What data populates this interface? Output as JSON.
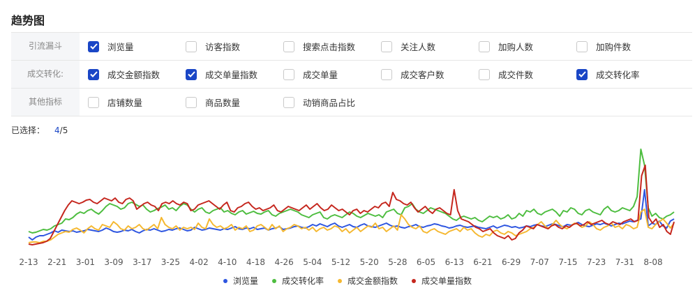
{
  "page_title": "趋势图",
  "filters": [
    {
      "label": "引流漏斗",
      "options": [
        {
          "label": "浏览量",
          "checked": true
        },
        {
          "label": "访客指数",
          "checked": false
        },
        {
          "label": "搜索点击指数",
          "checked": false
        },
        {
          "label": "关注人数",
          "checked": false
        },
        {
          "label": "加购人数",
          "checked": false
        },
        {
          "label": "加购件数",
          "checked": false
        }
      ]
    },
    {
      "label": "成交转化:",
      "options": [
        {
          "label": "成交金额指数",
          "checked": true
        },
        {
          "label": "成交单量指数",
          "checked": true
        },
        {
          "label": "成交单量",
          "checked": false
        },
        {
          "label": "成交客户数",
          "checked": false
        },
        {
          "label": "成交件数",
          "checked": false
        },
        {
          "label": "成交转化率",
          "checked": true
        }
      ]
    },
    {
      "label": "其他指标",
      "options": [
        {
          "label": "店铺数量",
          "checked": false
        },
        {
          "label": "商品数量",
          "checked": false
        },
        {
          "label": "动销商品占比",
          "checked": false
        }
      ]
    }
  ],
  "selection": {
    "label": "已选择：",
    "count": "4",
    "total": "/5"
  },
  "colors": {
    "accent": "#1a46c6",
    "border": "#e6e6e6",
    "header_bg": "#f5f6f8"
  },
  "chart_data": {
    "type": "line",
    "grid": false,
    "legend_position": "bottom",
    "x_ticks": [
      "2-13",
      "2-21",
      "3-01",
      "3-09",
      "3-17",
      "3-25",
      "4-02",
      "4-10",
      "4-18",
      "4-26",
      "5-04",
      "5-12",
      "5-20",
      "5-28",
      "6-05",
      "6-13",
      "6-21",
      "6-29",
      "7-07",
      "7-15",
      "7-23",
      "7-31",
      "8-08"
    ],
    "series": [
      {
        "name": "浏览量",
        "color": "#2d55e0",
        "values": [
          22,
          18,
          22,
          24,
          24,
          26,
          28,
          31,
          29,
          32,
          31,
          30,
          31,
          29,
          30,
          31,
          33,
          32,
          31,
          30,
          32,
          35,
          33,
          30,
          29,
          30,
          32,
          31,
          33,
          30,
          28,
          31,
          33,
          32,
          34,
          32,
          30,
          31,
          33,
          32,
          34,
          35,
          33,
          31,
          32,
          36,
          34,
          32,
          33,
          35,
          34,
          33,
          32,
          34,
          33,
          35,
          37,
          34,
          33,
          35,
          34,
          36,
          33,
          34,
          35,
          32,
          34,
          35,
          37,
          33,
          34,
          35,
          37,
          38,
          36,
          35,
          37,
          40,
          38,
          41,
          39,
          37,
          40,
          42,
          38,
          36,
          38,
          40,
          37,
          36,
          39,
          41,
          38,
          37,
          36,
          38,
          40,
          42,
          39,
          37,
          38,
          36,
          35,
          37,
          38,
          40,
          37,
          36,
          38,
          39,
          41,
          40,
          38,
          37,
          35,
          36,
          38,
          39,
          37,
          36,
          37,
          38,
          36,
          35,
          34,
          36,
          38,
          35,
          37,
          39,
          38,
          36,
          37,
          35,
          36,
          38,
          37,
          39,
          40,
          38,
          37,
          39,
          41,
          40,
          38,
          37,
          40,
          39,
          41,
          43,
          40,
          38,
          37,
          39,
          41,
          40,
          42,
          40,
          38,
          40,
          42,
          41,
          43,
          45,
          44,
          46,
          48,
          90,
          38,
          42,
          40,
          45,
          38,
          35,
          45,
          48
        ]
      },
      {
        "name": "成交转化率",
        "color": "#4dbd3f",
        "values": [
          30,
          28,
          29,
          31,
          33,
          32,
          34,
          38,
          40,
          42,
          48,
          47,
          50,
          55,
          58,
          56,
          60,
          62,
          58,
          55,
          60,
          66,
          70,
          68,
          66,
          62,
          64,
          70,
          72,
          69,
          66,
          68,
          62,
          58,
          60,
          63,
          65,
          68,
          62,
          64,
          60,
          66,
          70,
          68,
          62,
          58,
          62,
          64,
          58,
          56,
          60,
          62,
          64,
          58,
          60,
          56,
          54,
          58,
          60,
          55,
          57,
          59,
          56,
          55,
          58,
          60,
          54,
          52,
          56,
          58,
          60,
          62,
          60,
          58,
          54,
          52,
          50,
          54,
          56,
          58,
          50,
          48,
          52,
          54,
          52,
          50,
          54,
          58,
          56,
          52,
          50,
          53,
          56,
          54,
          52,
          54,
          50,
          58,
          60,
          62,
          56,
          54,
          64,
          66,
          70,
          62,
          58,
          56,
          60,
          64,
          62,
          60,
          58,
          56,
          52,
          48,
          46,
          50,
          52,
          50,
          48,
          50,
          46,
          44,
          48,
          52,
          50,
          52,
          48,
          50,
          54,
          48,
          50,
          56,
          52,
          60,
          58,
          62,
          56,
          54,
          58,
          60,
          62,
          58,
          52,
          60,
          58,
          64,
          62,
          56,
          54,
          60,
          62,
          58,
          56,
          54,
          62,
          66,
          60,
          58,
          60,
          64,
          62,
          60,
          66,
          80,
          148,
          125,
          64,
          52,
          56,
          50,
          48,
          52,
          54,
          58
        ]
      },
      {
        "name": "成交金额指数",
        "color": "#f5b830",
        "values": [
          14,
          15,
          15,
          14,
          16,
          16,
          18,
          22,
          26,
          28,
          30,
          29,
          33,
          35,
          32,
          28,
          34,
          38,
          34,
          32,
          40,
          38,
          36,
          44,
          40,
          34,
          32,
          38,
          34,
          36,
          40,
          34,
          32,
          36,
          40,
          34,
          50,
          40,
          36,
          34,
          38,
          32,
          36,
          34,
          36,
          33,
          42,
          36,
          34,
          48,
          40,
          36,
          38,
          34,
          36,
          40,
          32,
          36,
          34,
          38,
          30,
          32,
          38,
          40,
          36,
          32,
          40,
          34,
          38,
          30,
          34,
          36,
          40,
          38,
          34,
          36,
          32,
          36,
          30,
          34,
          36,
          32,
          34,
          38,
          36,
          30,
          34,
          28,
          32,
          36,
          30,
          34,
          38,
          36,
          42,
          34,
          36,
          30,
          34,
          38,
          32,
          54,
          48,
          40,
          36,
          34,
          38,
          30,
          28,
          32,
          34,
          30,
          28,
          26,
          30,
          32,
          34,
          30,
          36,
          32,
          34,
          28,
          24,
          22,
          26,
          24,
          30,
          32,
          28,
          26,
          30,
          28,
          24,
          26,
          28,
          30,
          34,
          36,
          40,
          44,
          38,
          34,
          40,
          46,
          40,
          36,
          34,
          38,
          42,
          40,
          36,
          38,
          44,
          40,
          34,
          32,
          36,
          38,
          42,
          36,
          38,
          34,
          40,
          38,
          34,
          36,
          58,
          62,
          36,
          34,
          40,
          44,
          48,
          42,
          35,
          42
        ]
      },
      {
        "name": "成交单量指数",
        "color": "#c5261d",
        "values": [
          12,
          11,
          12,
          13,
          14,
          16,
          20,
          30,
          40,
          50,
          60,
          68,
          74,
          72,
          70,
          72,
          75,
          76,
          72,
          70,
          74,
          78,
          76,
          74,
          78,
          72,
          70,
          76,
          78,
          74,
          62,
          66,
          70,
          72,
          68,
          66,
          60,
          70,
          72,
          70,
          74,
          70,
          68,
          72,
          70,
          60,
          62,
          68,
          70,
          72,
          74,
          70,
          66,
          62,
          68,
          72,
          60,
          58,
          64,
          66,
          70,
          72,
          66,
          62,
          64,
          60,
          62,
          64,
          68,
          60,
          58,
          62,
          66,
          64,
          62,
          60,
          64,
          68,
          62,
          66,
          70,
          64,
          60,
          62,
          68,
          64,
          60,
          62,
          58,
          54,
          60,
          62,
          56,
          60,
          58,
          62,
          66,
          64,
          70,
          72,
          66,
          86,
          76,
          74,
          70,
          68,
          72,
          64,
          58,
          62,
          66,
          60,
          56,
          62,
          64,
          60,
          56,
          54,
          90,
          60,
          48,
          46,
          44,
          40,
          36,
          34,
          30,
          32,
          34,
          28,
          24,
          22,
          20,
          24,
          18,
          20,
          28,
          32,
          38,
          36,
          34,
          40,
          38,
          36,
          34,
          38,
          40,
          36,
          34,
          38,
          36,
          40,
          42,
          38,
          40,
          44,
          40,
          42,
          44,
          46,
          42,
          40,
          44,
          42,
          40,
          44,
          46,
          48,
          44,
          46,
          110,
          125,
          50,
          42,
          48,
          36,
          40,
          30,
          26,
          44
        ]
      }
    ]
  }
}
